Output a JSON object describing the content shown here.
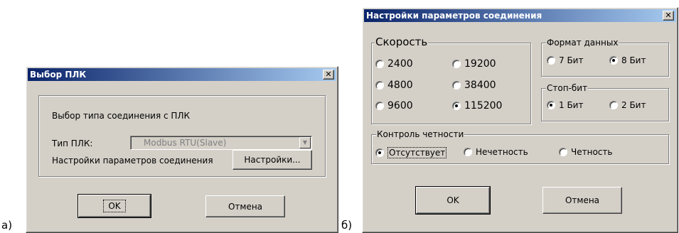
{
  "figure": {
    "label_a": "а)",
    "label_b": "б)"
  },
  "dialog_a": {
    "title": "Выбор ПЛК",
    "close_glyph": "✕",
    "group_label": "Выбор типа соединения с ПЛК",
    "plc_type_label": "Тип ПЛК:",
    "plc_type_value": "Modbus RTU(Slave)",
    "dropdown_arrow": "▼",
    "params_label": "Настройки параметров соединения",
    "settings_button": "Настройки...",
    "ok_button": "OK",
    "cancel_button": "Отмена"
  },
  "dialog_b": {
    "title": "Настройки параметров соединения",
    "close_glyph": "✕",
    "speed": {
      "title": "Скорость",
      "options": [
        "2400",
        "19200",
        "4800",
        "38400",
        "9600",
        "115200"
      ],
      "selected": "115200"
    },
    "data_format": {
      "title": "Формат данных",
      "options": [
        "7 Бит",
        "8 Бит"
      ],
      "selected": "8 Бит"
    },
    "stop_bits": {
      "title": "Стоп-бит",
      "options": [
        "1 Бит",
        "2 Бит"
      ],
      "selected": "1 Бит"
    },
    "parity": {
      "title": "Контроль четности",
      "options": [
        "Отсутствует",
        "Нечетность",
        "Четность"
      ],
      "selected": "Отсутствует"
    },
    "ok_button": "OK",
    "cancel_button": "Отмена"
  },
  "colors": {
    "face": "#d4d0c8",
    "title_start": "#0a246a",
    "title_end": "#a6caf0"
  }
}
